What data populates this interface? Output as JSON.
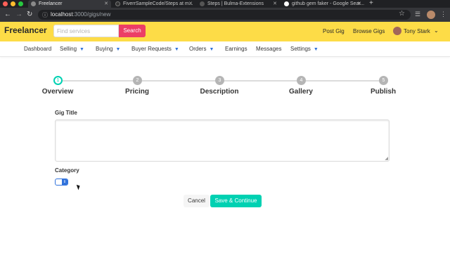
{
  "browser": {
    "tabs": [
      {
        "title": "Freelancer",
        "active": true
      },
      {
        "title": "FiverrSampleCode/Steps at m...",
        "active": false
      },
      {
        "title": "Steps | Bulma-Extensions",
        "active": false
      },
      {
        "title": "github gem faker - Google Sear...",
        "active": false
      }
    ],
    "url_host": "localhost",
    "url_path": ":3000/gigs/new",
    "traffic_colors": [
      "#ff5f57",
      "#febc2e",
      "#28c840"
    ]
  },
  "navbar": {
    "brand": "Freelancer",
    "search_placeholder": "Find services",
    "search_button": "Search",
    "post_gig": "Post Gig",
    "browse_gigs": "Browse Gigs",
    "user_name": "Tony Stark"
  },
  "submenu": {
    "items": [
      {
        "label": "Dashboard",
        "caret": false
      },
      {
        "label": "Selling",
        "caret": true
      },
      {
        "label": "Buying",
        "caret": true
      },
      {
        "label": "Buyer Requests",
        "caret": true
      },
      {
        "label": "Orders",
        "caret": true
      },
      {
        "label": "Earnings",
        "caret": false
      },
      {
        "label": "Messages",
        "caret": false
      },
      {
        "label": "Settings",
        "caret": true
      }
    ]
  },
  "steps": [
    {
      "number": "1",
      "label": "Overview",
      "active": true
    },
    {
      "number": "2",
      "label": "Pricing",
      "active": false
    },
    {
      "number": "3",
      "label": "Description",
      "active": false
    },
    {
      "number": "4",
      "label": "Gallery",
      "active": false
    },
    {
      "number": "5",
      "label": "Publish",
      "active": false
    }
  ],
  "form": {
    "gig_title_label": "Gig Title",
    "gig_title_value": "",
    "category_label": "Category",
    "cancel_label": "Cancel",
    "save_label": "Save & Continue"
  },
  "colors": {
    "navbar_bg": "#fddc47",
    "search_button": "#ec3e66",
    "primary": "#00d1b2",
    "link": "#3273dc"
  }
}
